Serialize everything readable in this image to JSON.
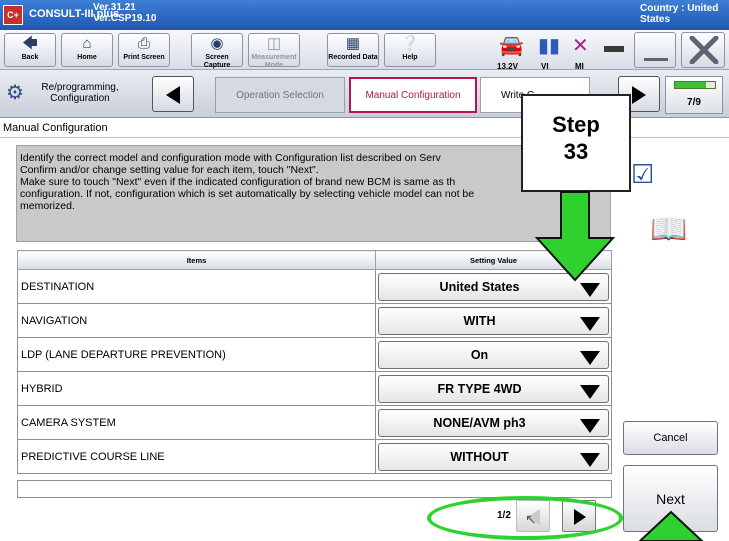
{
  "titlebar": {
    "logo": "C+",
    "app_name": "CONSULT-III plus",
    "version_line1": "Ver.31.21",
    "version_line2": "Ver.CSP19.10",
    "country_line1": "Country : United",
    "country_line2": "States"
  },
  "toolbar": {
    "back": "Back",
    "home": "Home",
    "print_screen": "Print Screen",
    "screen_capture": "Screen Capture",
    "measurement_mode": "Measurement Mode",
    "recorded_data": "Recorded Data",
    "help": "Help",
    "voltage": "13.2V",
    "vi": "VI",
    "mi": "MI"
  },
  "breadcrumb": {
    "reprogramming": "Re/programming, Configuration",
    "operation_selection": "Operation Selection",
    "manual_configuration": "Manual Configuration",
    "write": "Write C",
    "progress": "7/9",
    "progress_fraction": 0.78
  },
  "page": {
    "title": "Manual Configuration",
    "instructions": [
      "Identify the correct model and configuration mode with Configuration list described on Serv",
      "Confirm and/or change setting value for each item, touch \"Next\".",
      "Make sure to touch \"Next\" even if the indicated configuration of brand new BCM is same as th",
      "configuration. If not, configuration which is set automatically by selecting vehicle model can not be",
      "memorized."
    ]
  },
  "table": {
    "header_items": "Items",
    "header_value": "Setting Value",
    "rows": [
      {
        "item": "DESTINATION",
        "value": "United States"
      },
      {
        "item": "NAVIGATION",
        "value": "WITH"
      },
      {
        "item": "LDP (LANE DEPARTURE PREVENTION)",
        "value": "On"
      },
      {
        "item": "HYBRID",
        "value": "FR TYPE 4WD"
      },
      {
        "item": "CAMERA SYSTEM",
        "value": "NONE/AVM ph3"
      },
      {
        "item": "PREDICTIVE COURSE LINE",
        "value": "WITHOUT"
      }
    ]
  },
  "pager": {
    "text": "1/2"
  },
  "buttons": {
    "cancel": "Cancel",
    "next": "Next"
  },
  "annotation": {
    "step_label": "Step",
    "step_number": "33",
    "arrow_color": "#2fd12f"
  },
  "icons": {
    "back": "back-arrow-icon",
    "home": "home-icon",
    "print": "printer-icon",
    "capture": "camera-icon",
    "measure": "measurement-icon",
    "recorded": "recorded-data-icon",
    "help": "help-icon",
    "car": "car-icon",
    "signal": "signal-icon",
    "cross": "cross-icon",
    "battery": "battery-icon",
    "minimize": "minimize-icon",
    "close": "close-icon",
    "doc": "checklist-document-icon",
    "book": "book-icon"
  }
}
